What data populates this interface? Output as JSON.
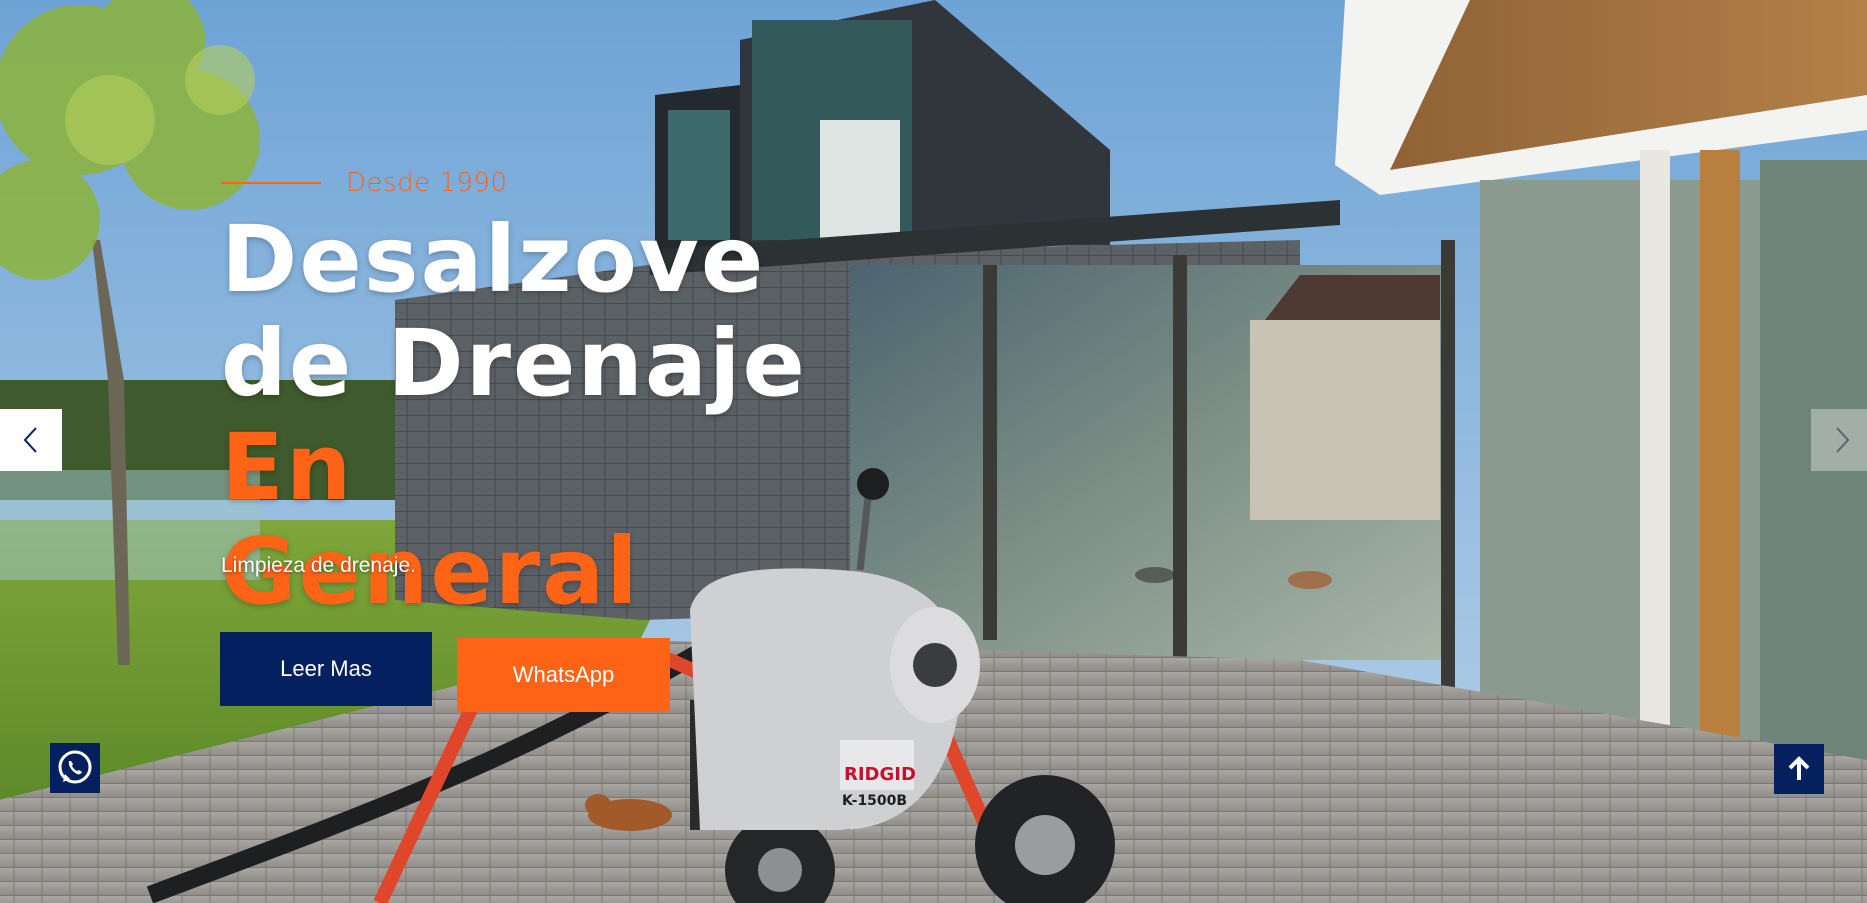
{
  "hero": {
    "eyebrow": "Desde 1990",
    "title_line1": "Desalzove",
    "title_line2_white": "de Drenaje ",
    "title_line2_accent": "En",
    "title_line3_accent": "General",
    "subtitle": "Limpieza de drenaje.",
    "primary_button": "Leer Mas",
    "whatsapp_button": "WhatsApp",
    "machine_brand": "RIDGID",
    "machine_model": "K-1500B"
  },
  "colors": {
    "accent": "#ff6316",
    "navy": "#05205e",
    "white": "#ffffff"
  },
  "icons": {
    "prev": "chevron-left-icon",
    "next": "chevron-right-icon",
    "whatsapp": "whatsapp-icon",
    "scroll_top": "arrow-up-icon"
  }
}
